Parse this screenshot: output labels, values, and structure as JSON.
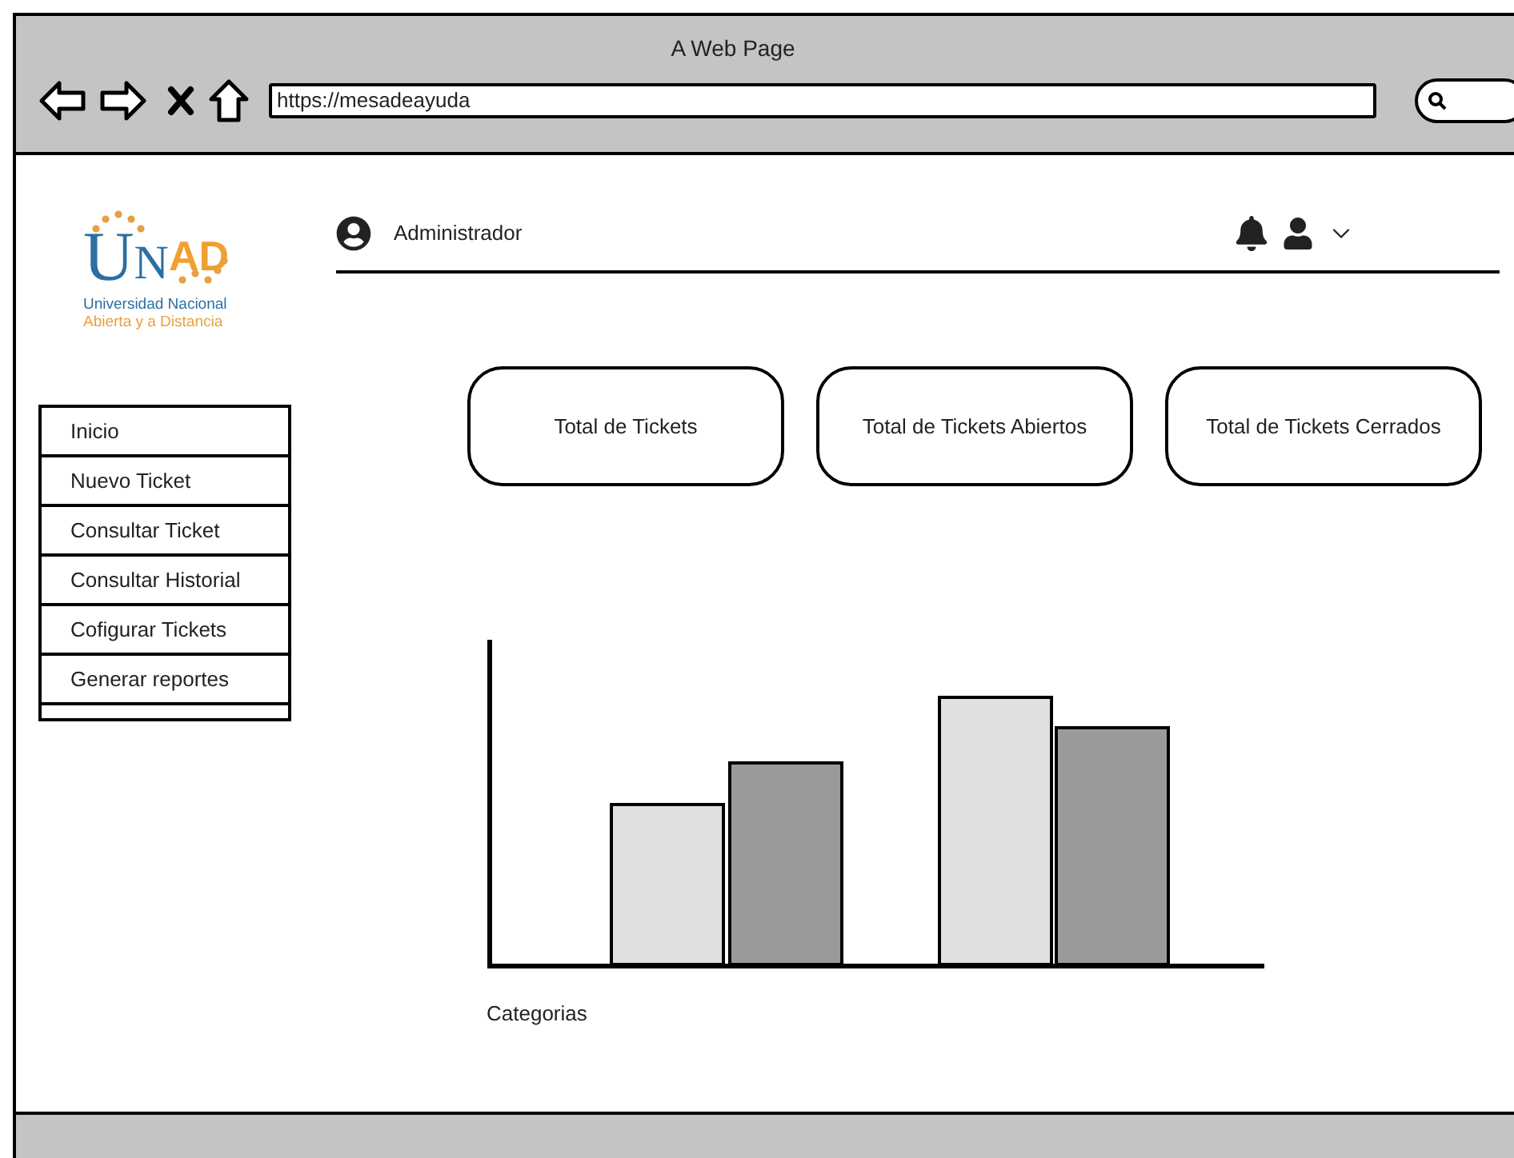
{
  "window": {
    "title": "A Web Page",
    "url": "https://mesadeayuda"
  },
  "logo": {
    "letters": [
      "U",
      "N",
      "AD"
    ],
    "line_1": "Universidad Nacional",
    "line_2": "Abierta y a Distancia"
  },
  "header": {
    "user": "Administrador"
  },
  "menu": [
    {
      "label": "Inicio"
    },
    {
      "label": "Nuevo Ticket"
    },
    {
      "label": "Consultar Ticket"
    },
    {
      "label": "Consultar Historial"
    },
    {
      "label": "Cofigurar Tickets"
    },
    {
      "label": "Generar reportes"
    }
  ],
  "cards": [
    {
      "label": "Total de Tickets"
    },
    {
      "label": "Total de Tickets Abiertos"
    },
    {
      "label": "Total de Tickets Cerrados"
    }
  ],
  "chart": {
    "xlabel": "Categorias"
  }
}
